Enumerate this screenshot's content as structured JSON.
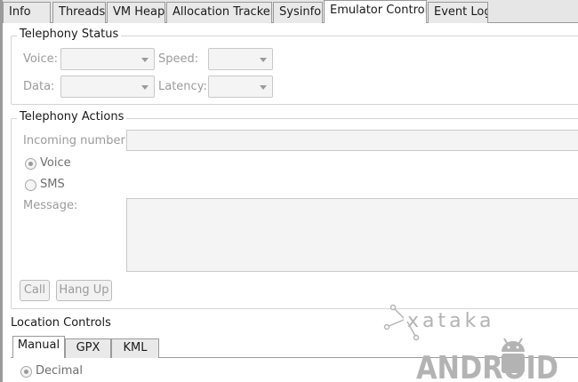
{
  "tabs": [
    "Info",
    "Threads",
    "VM Heap",
    "Allocation Tracker",
    "Sysinfo",
    "Emulator Control",
    "Event Log"
  ],
  "telephony_status": {
    "title": "Telephony Status",
    "voice_label": "Voice:",
    "speed_label": "Speed:",
    "data_label": "Data:",
    "latency_label": "Latency:"
  },
  "telephony_actions": {
    "title": "Telephony Actions",
    "incoming_label": "Incoming number:",
    "incoming_value": "",
    "voice_label": "Voice",
    "sms_label": "SMS",
    "selected": "Voice",
    "message_label": "Message:",
    "message_value": "",
    "call_label": "Call",
    "hangup_label": "Hang Up"
  },
  "location_controls": {
    "title": "Location Controls",
    "tabs": [
      "Manual",
      "GPX",
      "KML"
    ],
    "active_tab": "Manual",
    "decimal_label": "Decimal"
  },
  "watermark": {
    "line1": "xataka",
    "line2": "ANDROID"
  },
  "colors": {
    "accent_gray": "#9a9a9a",
    "watermark": "#b3b3b3"
  }
}
